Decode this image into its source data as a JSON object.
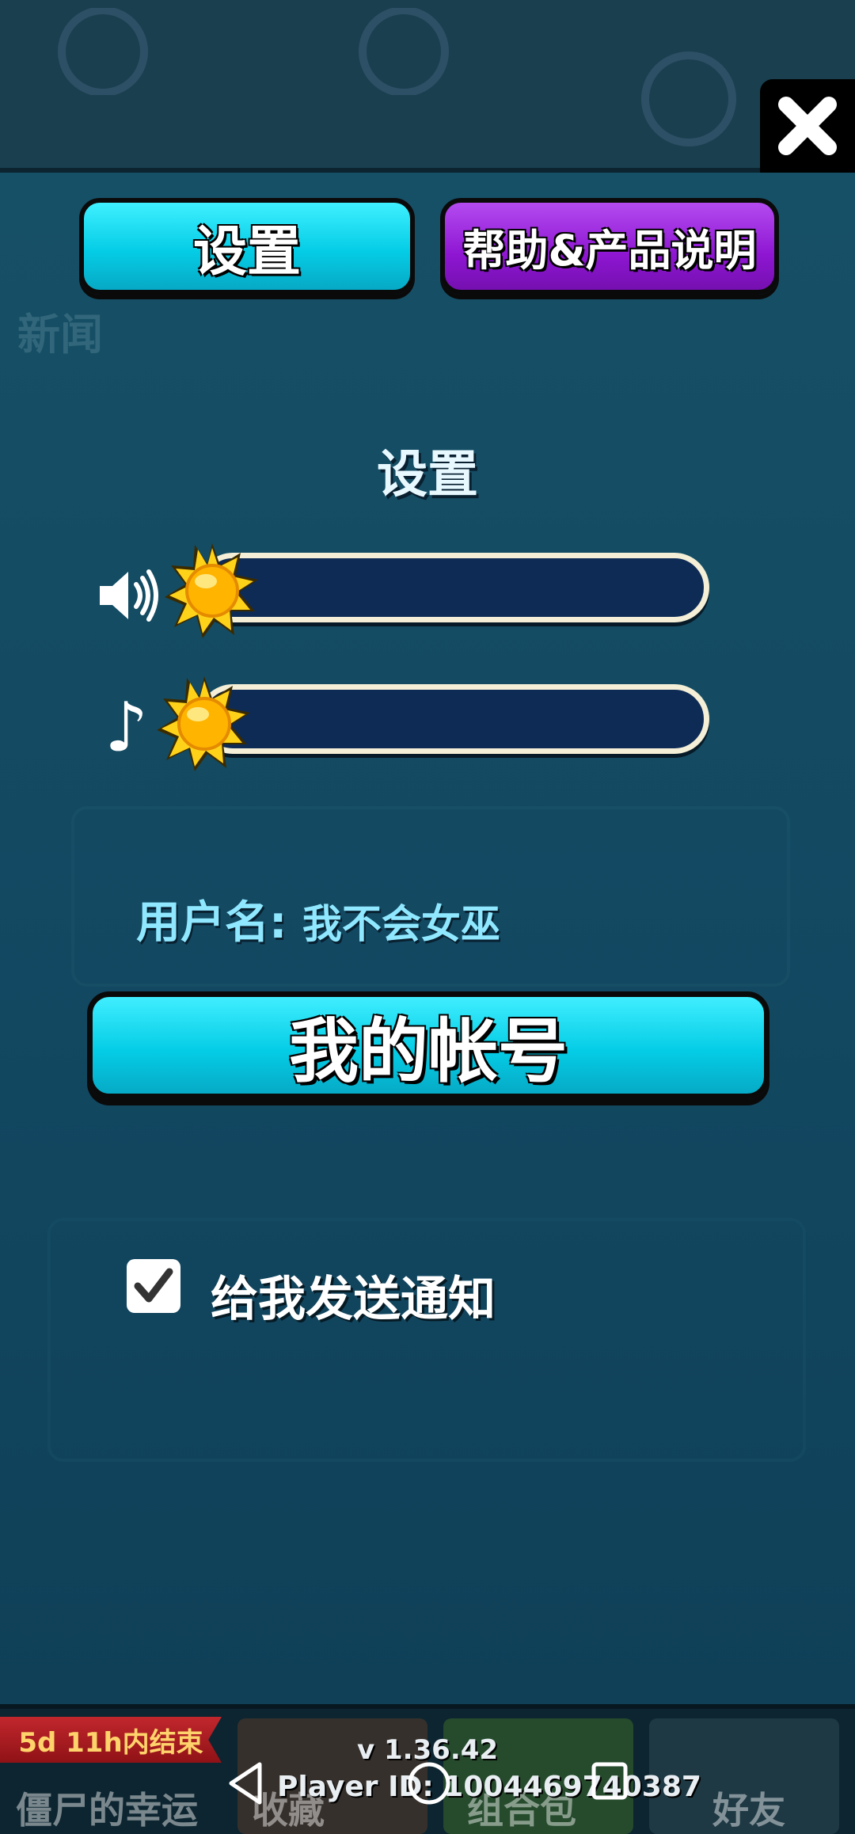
{
  "tabs": {
    "settings_label": "设置",
    "help_label": "帮助&产品说明"
  },
  "settings": {
    "title": "设置",
    "sound_volume": 0,
    "music_volume": 0
  },
  "account": {
    "username_label": "用户名:",
    "username_value": "我不会女巫",
    "my_account_button": "我的帐号"
  },
  "notifications": {
    "label": "给我发送通知",
    "checked": true
  },
  "background": {
    "news_label": "新闻",
    "event_banner": "5d 11h内结束",
    "zombie_luck_label": "僵尸的幸运",
    "collection_label": "收藏",
    "package_label": "组合包",
    "friends_label": "好友"
  },
  "footer": {
    "version": "v 1.36.42",
    "player_id": "Player ID: 1004469740387"
  },
  "colors": {
    "accent_cyan": "#05cde6",
    "accent_purple": "#8e16d2",
    "panel": "#124760",
    "track": "#0e2b56"
  },
  "icons": [
    "close-icon",
    "speaker-icon",
    "music-note-icon",
    "sun-icon",
    "check-icon",
    "back-icon",
    "home-icon",
    "recents-icon"
  ]
}
